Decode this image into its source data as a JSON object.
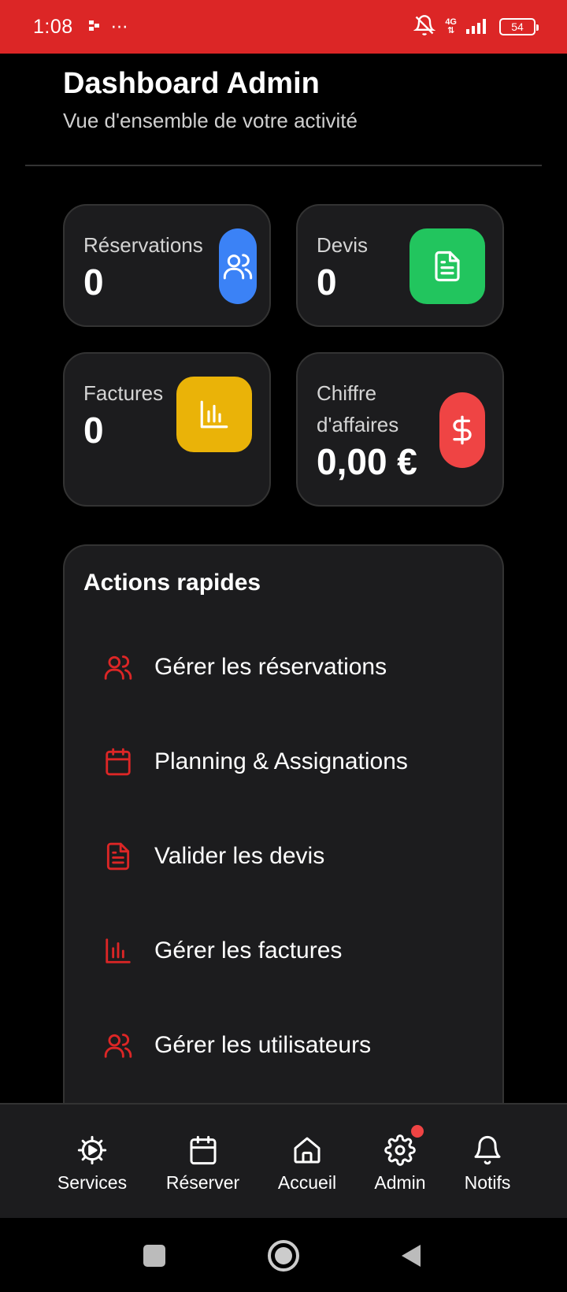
{
  "status_bar": {
    "time": "1:08",
    "extra": "⋯",
    "battery": "54",
    "network": "4G"
  },
  "header": {
    "title": "Dashboard Admin",
    "subtitle": "Vue d'ensemble de votre activité"
  },
  "stats": [
    {
      "label": "Réservations",
      "value": "0",
      "icon": "users-icon",
      "color": "#3b82f6"
    },
    {
      "label": "Devis",
      "value": "0",
      "icon": "document-icon",
      "color": "#22c55e"
    },
    {
      "label": "Factures",
      "value": "0",
      "icon": "bar-chart-icon",
      "color": "#eab308"
    },
    {
      "label": "Chiffre d'affaires",
      "label_line1": "Chiffre",
      "label_line2": "d'affaires",
      "value": "0,00 €",
      "icon": "dollar-icon",
      "color": "#ef4444"
    }
  ],
  "actions": {
    "title": "Actions rapides",
    "accent": "#dc2626",
    "items": [
      {
        "label": "Gérer les réservations",
        "icon": "users-icon"
      },
      {
        "label": "Planning & Assignations",
        "icon": "calendar-icon"
      },
      {
        "label": "Valider les devis",
        "icon": "document-icon"
      },
      {
        "label": "Gérer les factures",
        "icon": "bar-chart-icon"
      },
      {
        "label": "Gérer les utilisateurs",
        "icon": "users-icon"
      }
    ]
  },
  "bottom_nav": [
    {
      "label": "Services",
      "icon": "services-icon"
    },
    {
      "label": "Réserver",
      "icon": "calendar-icon"
    },
    {
      "label": "Accueil",
      "icon": "home-icon"
    },
    {
      "label": "Admin",
      "icon": "gear-icon",
      "badge": true
    },
    {
      "label": "Notifs",
      "icon": "bell-icon"
    }
  ]
}
